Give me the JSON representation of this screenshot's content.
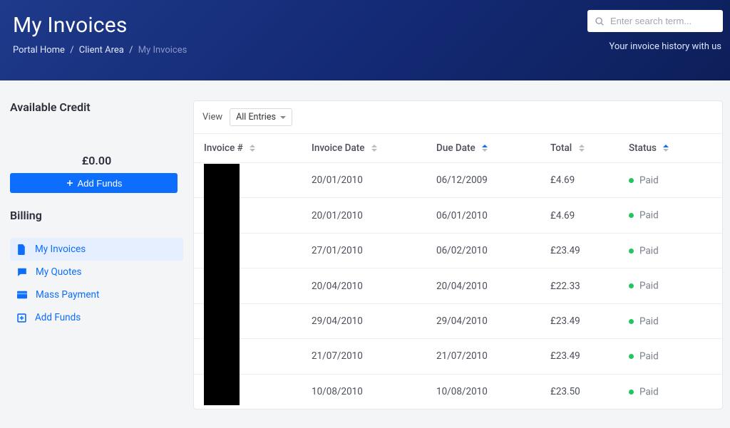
{
  "header": {
    "title": "My Invoices",
    "breadcrumb": {
      "home": "Portal Home",
      "area": "Client Area",
      "current": "My Invoices"
    },
    "subtitle": "Your invoice history with us",
    "search_placeholder": "Enter search term..."
  },
  "sidebar": {
    "credit": {
      "title": "Available Credit",
      "amount": "£0.00",
      "add_funds_label": "Add Funds"
    },
    "billing": {
      "title": "Billing",
      "items": [
        {
          "label": "My Invoices",
          "icon": "file-icon",
          "active": true
        },
        {
          "label": "My Quotes",
          "icon": "chat-icon",
          "active": false
        },
        {
          "label": "Mass Payment",
          "icon": "card-icon",
          "active": false
        },
        {
          "label": "Add Funds",
          "icon": "plus-box-icon",
          "active": false
        }
      ]
    }
  },
  "table": {
    "view_label": "View",
    "filter_value": "All Entries",
    "columns": {
      "invoice": "Invoice #",
      "date": "Invoice Date",
      "due": "Due Date",
      "total": "Total",
      "status": "Status"
    },
    "rows": [
      {
        "date": "20/01/2010",
        "due": "06/12/2009",
        "total": "£4.69",
        "status": "Paid"
      },
      {
        "date": "20/01/2010",
        "due": "06/01/2010",
        "total": "£4.69",
        "status": "Paid"
      },
      {
        "date": "27/01/2010",
        "due": "06/02/2010",
        "total": "£23.49",
        "status": "Paid"
      },
      {
        "date": "20/04/2010",
        "due": "20/04/2010",
        "total": "£22.33",
        "status": "Paid"
      },
      {
        "date": "29/04/2010",
        "due": "29/04/2010",
        "total": "£23.49",
        "status": "Paid"
      },
      {
        "date": "21/07/2010",
        "due": "21/07/2010",
        "total": "£23.49",
        "status": "Paid"
      },
      {
        "date": "10/08/2010",
        "due": "10/08/2010",
        "total": "£23.50",
        "status": "Paid"
      }
    ],
    "status_color": "#22c55e"
  }
}
